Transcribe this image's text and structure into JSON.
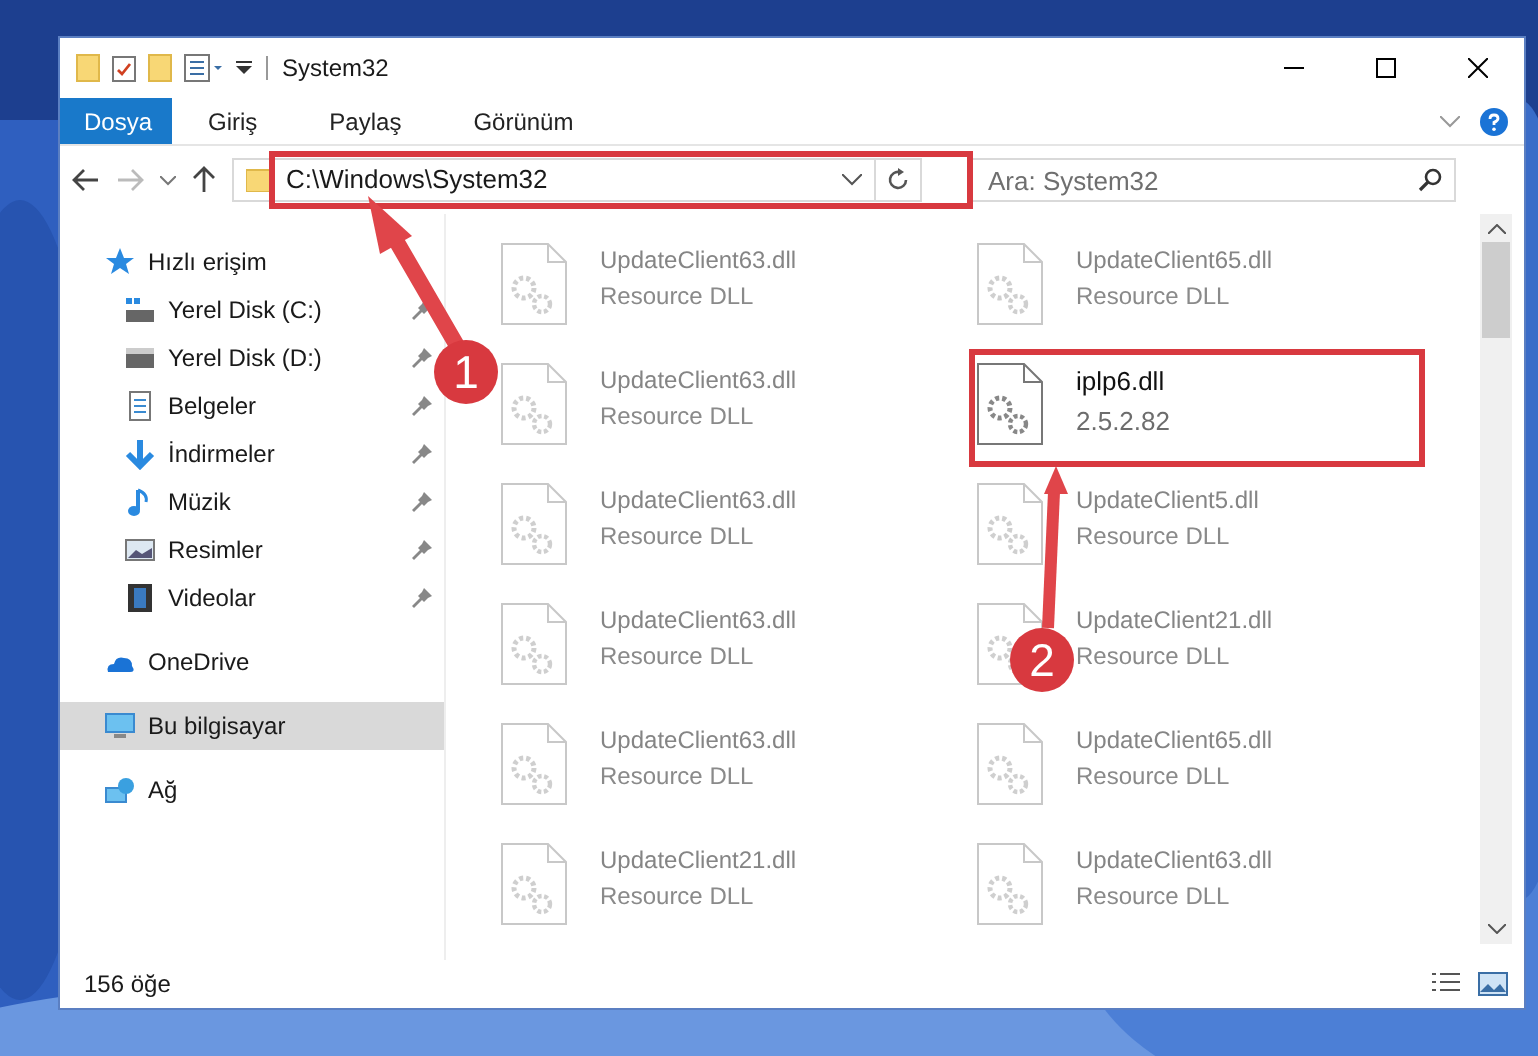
{
  "window": {
    "title": "System32"
  },
  "ribbon_tabs": [
    {
      "label": "Dosya",
      "selected": true
    },
    {
      "label": "Giriş",
      "selected": false
    },
    {
      "label": "Paylaş",
      "selected": false
    },
    {
      "label": "Görünüm",
      "selected": false
    }
  ],
  "address_bar": {
    "value": "C:\\Windows\\System32"
  },
  "search": {
    "placeholder": "Ara: System32"
  },
  "sidebar": {
    "items": [
      {
        "label": "Hızlı erişim",
        "kind": "star",
        "selected": false,
        "children": [
          {
            "label": "Yerel Disk (C:)",
            "kind": "drive-c",
            "pinned": true
          },
          {
            "label": "Yerel Disk (D:)",
            "kind": "drive",
            "pinned": true
          },
          {
            "label": "Belgeler",
            "kind": "document",
            "pinned": true
          },
          {
            "label": "İndirmeler",
            "kind": "download",
            "pinned": true
          },
          {
            "label": "Müzik",
            "kind": "music",
            "pinned": true
          },
          {
            "label": "Resimler",
            "pinned": true
          },
          {
            "label": "Videolar",
            "kind": "video",
            "pinned": true
          }
        ]
      },
      {
        "label": "OneDrive",
        "kind": "cloud",
        "selected": false
      },
      {
        "label": "Bu bilgisayar",
        "kind": "computer",
        "selected": true
      },
      {
        "label": "Ağ",
        "kind": "network",
        "selected": false
      }
    ]
  },
  "files": [
    {
      "name": "UpdateClient63.dll",
      "detail": "Resource DLL",
      "blurred": true
    },
    {
      "name": "UpdateClient65.dll",
      "detail": "Resource DLL",
      "blurred": true
    },
    {
      "name": "UpdateClient63.dll",
      "detail": "Resource DLL",
      "blurred": true
    },
    {
      "name": "iplp6.dll",
      "detail": "2.5.2.82",
      "blurred": false
    },
    {
      "name": "UpdateClient63.dll",
      "detail": "Resource DLL",
      "blurred": true
    },
    {
      "name": "UpdateClient5.dll",
      "detail": "Resource DLL",
      "blurred": true
    },
    {
      "name": "UpdateClient63.dll",
      "detail": "Resource DLL",
      "blurred": true
    },
    {
      "name": "UpdateClient21.dll",
      "detail": "Resource DLL",
      "blurred": true
    },
    {
      "name": "UpdateClient63.dll",
      "detail": "Resource DLL",
      "blurred": true
    },
    {
      "name": "UpdateClient65.dll",
      "detail": "Resource DLL",
      "blurred": true
    },
    {
      "name": "UpdateClient21.dll",
      "detail": "Resource DLL",
      "blurred": true
    },
    {
      "name": "UpdateClient63.dll",
      "detail": "Resource DLL",
      "blurred": true
    }
  ],
  "status_bar": {
    "item_count": "156 öğe"
  },
  "annotations": [
    {
      "label": "1"
    },
    {
      "label": "2"
    }
  ]
}
